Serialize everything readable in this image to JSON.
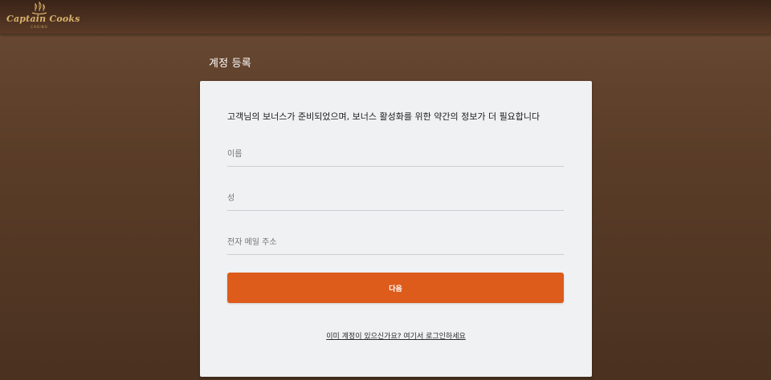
{
  "header": {
    "logo": {
      "brand": "Captain Cooks",
      "sub": "CASINO",
      "icon": "ship-sail-icon",
      "color": "#d9b36c"
    }
  },
  "page": {
    "title": "계정 등록"
  },
  "form": {
    "intro": "고객님의 보너스가 준비되었으며, 보너스 활성화를 위한 약간의 정보가 더 필요합니다",
    "first_name": {
      "placeholder": "이름",
      "value": ""
    },
    "last_name": {
      "placeholder": "성",
      "value": ""
    },
    "email": {
      "placeholder": "전자 메일 주소",
      "value": ""
    },
    "next_label": "다음",
    "login_link": "이미 계정이 있으신가요? 여기서 로그인하세요"
  },
  "colors": {
    "accent": "#dd5c1c",
    "background": "#5a3d28",
    "card": "#f0f1f2"
  }
}
